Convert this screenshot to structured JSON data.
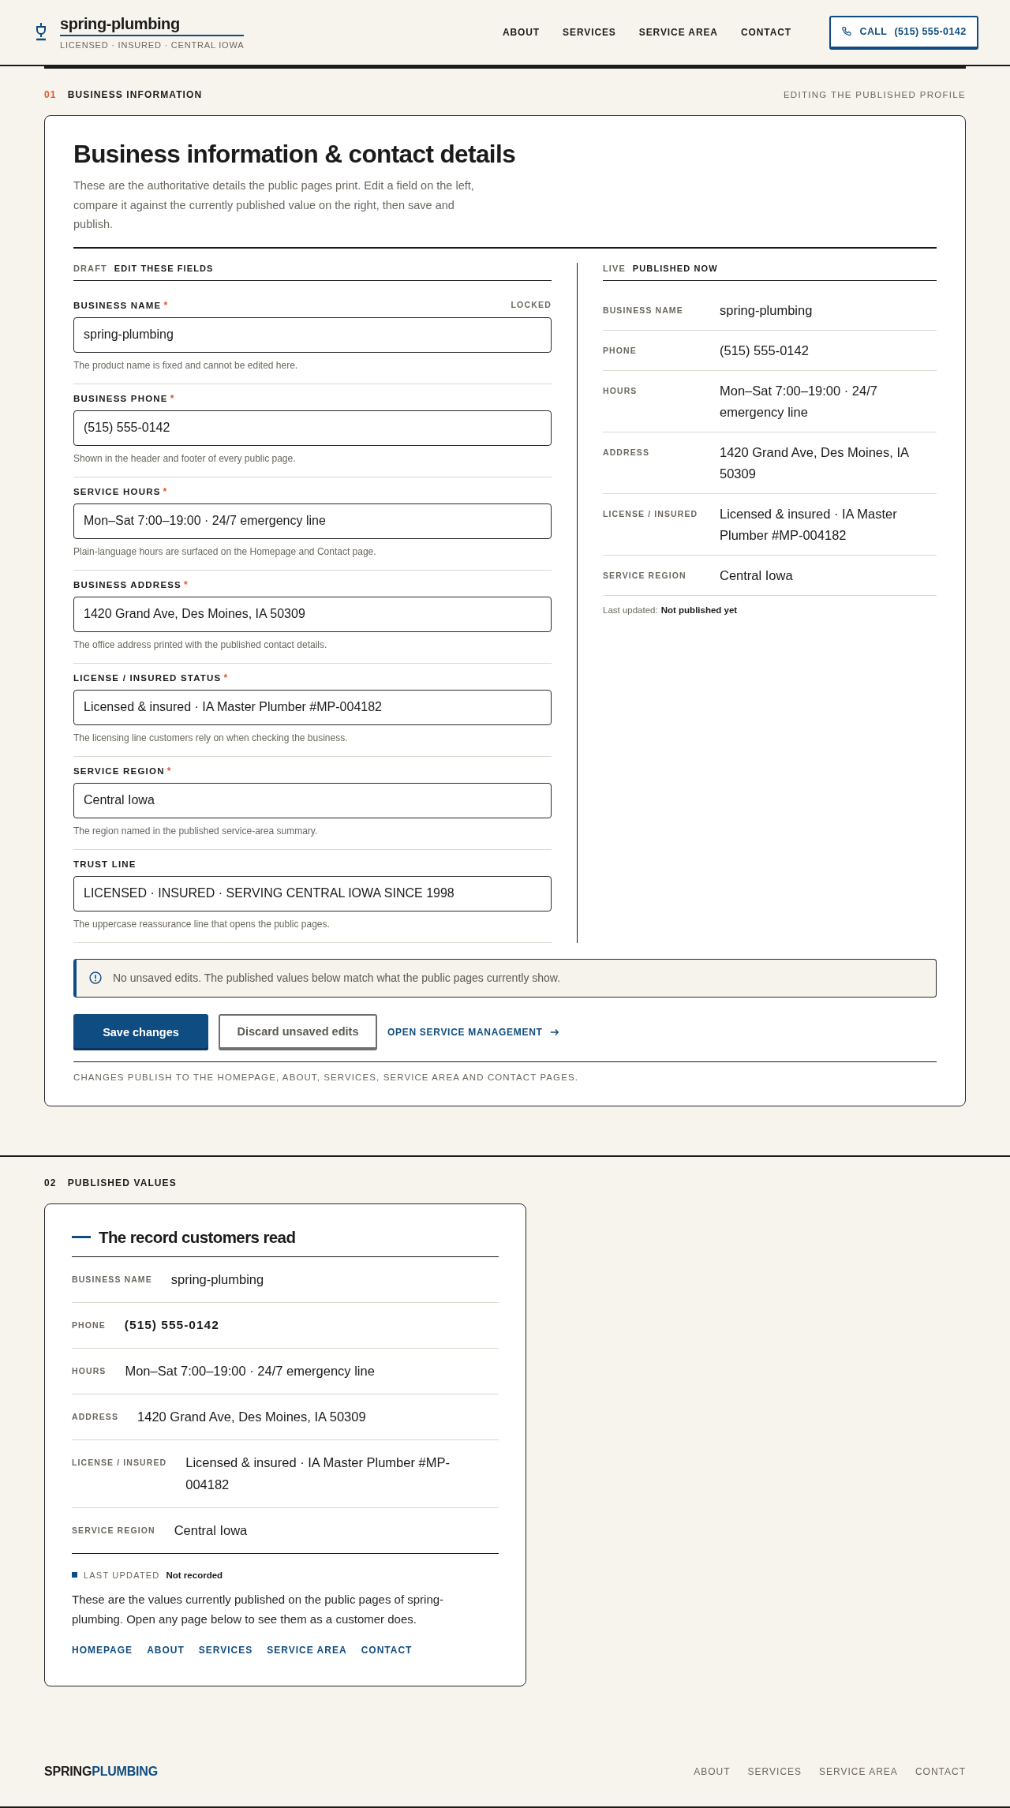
{
  "header": {
    "brand": "spring-plumbing",
    "tagline": "LICENSED · INSURED · CENTRAL IOWA",
    "nav": [
      {
        "label": "ABOUT"
      },
      {
        "label": "SERVICES"
      },
      {
        "label": "SERVICE AREA"
      },
      {
        "label": "CONTACT"
      }
    ],
    "call_button": {
      "label": "CALL",
      "phone": "(515) 555-0142"
    }
  },
  "section_1": {
    "number": "01",
    "title": "BUSINESS INFORMATION",
    "note": "EDITING THE PUBLISHED PROFILE"
  },
  "editor": {
    "title": "Business information & contact details",
    "description": "These are the authoritative details the public pages print. Edit a field on the left, compare it against the currently published value on the right, then save and publish.",
    "draft": {
      "tag": "DRAFT",
      "heading": "EDIT THESE FIELDS",
      "fields": [
        {
          "label": "BUSINESS NAME",
          "marker": "*",
          "badge": "LOCKED",
          "value": "spring-plumbing",
          "help": "The product name is fixed and cannot be edited here."
        },
        {
          "label": "BUSINESS PHONE",
          "marker": "*",
          "value": "(515) 555-0142",
          "help": "Shown in the header and footer of every public page."
        },
        {
          "label": "SERVICE HOURS",
          "marker": "*",
          "value": "Mon–Sat 7:00–19:00 · 24/7 emergency line",
          "help": "Plain-language hours are surfaced on the Homepage and Contact page."
        },
        {
          "label": "BUSINESS ADDRESS",
          "marker": "*",
          "value": "1420 Grand Ave, Des Moines, IA 50309",
          "help": "The office address printed with the published contact details."
        },
        {
          "label": "LICENSE / INSURED STATUS",
          "marker": "*",
          "value": "Licensed & insured · IA Master Plumber #MP-004182",
          "help": "The licensing line customers rely on when checking the business."
        },
        {
          "label": "SERVICE REGION",
          "marker": "*",
          "value": "Central Iowa",
          "help": "The region named in the published service-area summary."
        },
        {
          "label": "TRUST LINE",
          "value": "LICENSED · INSURED · SERVING CENTRAL IOWA SINCE 1998",
          "help": "The uppercase reassurance line that opens the public pages."
        }
      ]
    },
    "live": {
      "tag": "LIVE",
      "heading": "PUBLISHED NOW",
      "rows": [
        {
          "label": "BUSINESS NAME",
          "value": "spring-plumbing"
        },
        {
          "label": "PHONE",
          "value": "(515) 555-0142"
        },
        {
          "label": "HOURS",
          "value": "Mon–Sat 7:00–19:00 · 24/7 emergency line"
        },
        {
          "label": "ADDRESS",
          "value": "1420 Grand Ave, Des Moines, IA 50309"
        },
        {
          "label": "LICENSE / INSURED",
          "value": "Licensed & insured · IA Master Plumber #MP-004182"
        },
        {
          "label": "SERVICE REGION",
          "value": "Central Iowa"
        }
      ],
      "last_updated": {
        "label": "Last updated:",
        "value": "Not published yet"
      }
    },
    "notice": "No unsaved edits. The published values below match what the public pages currently show.",
    "save_button": "Save changes",
    "discard_button": "Discard unsaved edits",
    "service_link": "OPEN SERVICE MANAGEMENT",
    "footnote": "CHANGES PUBLISH TO THE HOMEPAGE, ABOUT, SERVICES, SERVICE AREA AND CONTACT PAGES."
  },
  "section_2": {
    "number": "02",
    "title": "PUBLISHED VALUES"
  },
  "record": {
    "title": "The record customers read",
    "rows": [
      {
        "label": "BUSINESS NAME",
        "value": "spring-plumbing",
        "kind": "text"
      },
      {
        "label": "PHONE",
        "value": "(515) 555-0142",
        "kind": "phone"
      },
      {
        "label": "HOURS",
        "value": "Mon–Sat 7:00–19:00 · 24/7 emergency line",
        "kind": "text"
      },
      {
        "label": "ADDRESS",
        "value": "1420 Grand Ave, Des Moines, IA 50309",
        "kind": "text"
      },
      {
        "label": "LICENSE / INSURED",
        "value": "Licensed & insured · IA Master Plumber #MP-004182",
        "kind": "text"
      },
      {
        "label": "SERVICE REGION",
        "value": "Central Iowa",
        "kind": "text"
      }
    ],
    "last_updated": {
      "label": "LAST UPDATED",
      "value": "Not recorded"
    },
    "description": "These are the values currently published on the public pages of spring-plumbing. Open any page below to see them as a customer does.",
    "links": [
      {
        "label": "HOMEPAGE"
      },
      {
        "label": "ABOUT"
      },
      {
        "label": "SERVICES"
      },
      {
        "label": "SERVICE AREA"
      },
      {
        "label": "CONTACT"
      }
    ]
  },
  "footer": {
    "logo_primary": "SPRING",
    "logo_accent": "PLUMBING",
    "nav": [
      {
        "label": "ABOUT"
      },
      {
        "label": "SERVICES"
      },
      {
        "label": "SERVICE AREA"
      },
      {
        "label": "CONTACT"
      }
    ]
  }
}
